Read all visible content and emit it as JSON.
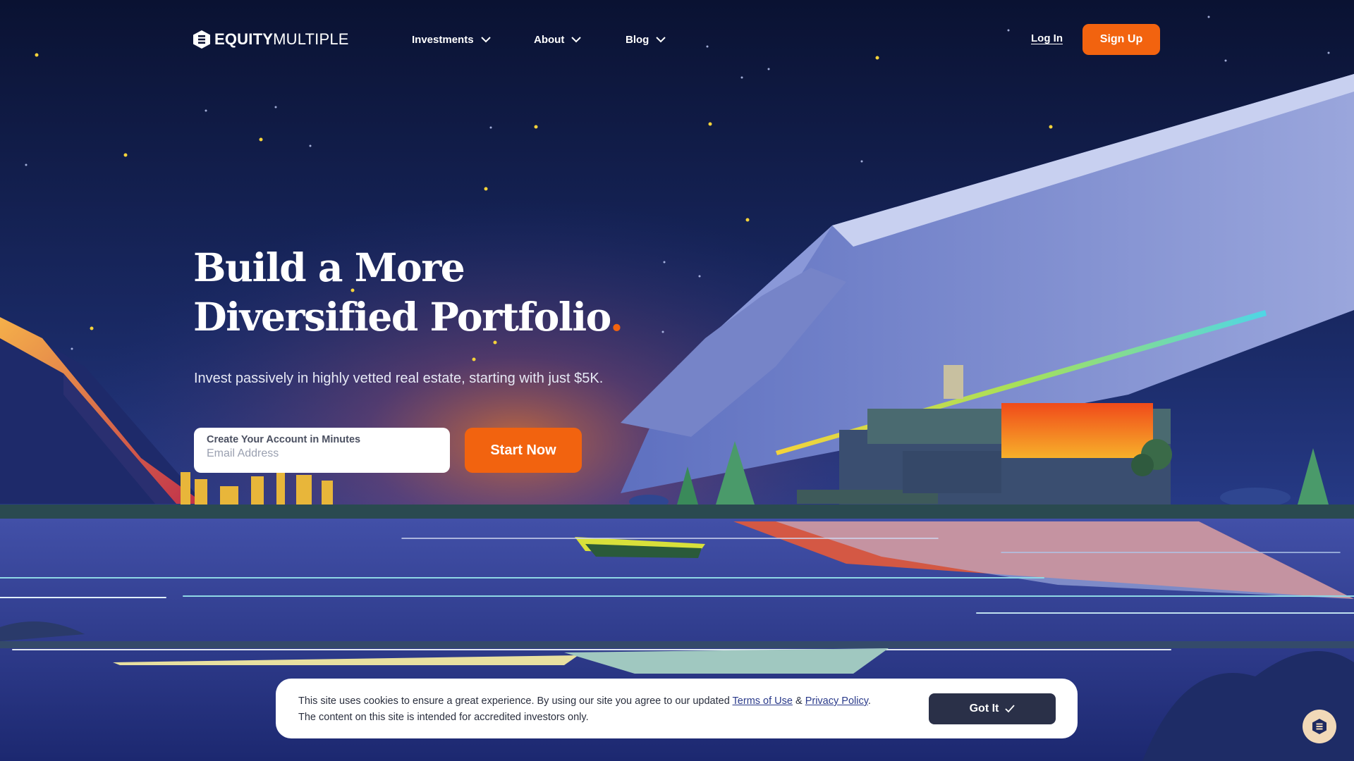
{
  "brand": {
    "name_bold": "EQUITY",
    "name_light": "MULTIPLE",
    "accent_color": "#f2630f"
  },
  "nav": {
    "items": [
      {
        "label": "Investments",
        "icon": "chevron-down-icon"
      },
      {
        "label": "About",
        "icon": "chevron-down-icon"
      },
      {
        "label": "Blog",
        "icon": "chevron-down-icon"
      }
    ],
    "login_label": "Log In",
    "signup_label": "Sign Up"
  },
  "hero": {
    "headline_line1": "Build a More",
    "headline_line2": "Diversified Portfolio",
    "headline_dot": ".",
    "subhead": "Invest passively in highly vetted real estate, starting with just $5K.",
    "email_label": "Create Your Account in Minutes",
    "email_placeholder": "Email Address",
    "cta_label": "Start Now"
  },
  "cookie": {
    "text_before": "This site uses cookies to ensure a great experience. By using our site you agree to our updated ",
    "terms_label": "Terms of Use",
    "amp": " & ",
    "privacy_label": "Privacy Policy",
    "period": ".",
    "line2": "The content on this site is intended for accredited investors only.",
    "button_label": "Got It",
    "button_icon": "check-icon"
  },
  "chat": {
    "icon": "chat-icon",
    "color": "#f1d9b8"
  }
}
